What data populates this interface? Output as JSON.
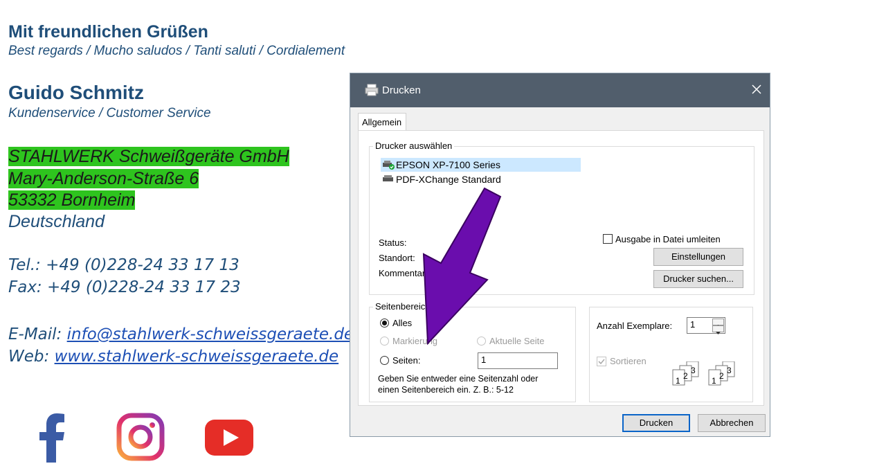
{
  "signature": {
    "greeting": "Mit freundlichen Grüßen",
    "greeting_sub": "Best regards / Mucho saludos / Tanti saluti / Cordialement",
    "name": "Guido Schmitz",
    "role": "Kundenservice / Customer Service",
    "company": "STAHLWERK Schweißgeräte GmbH",
    "street": "Mary-Anderson-Straße 6",
    "city": "53332 Bornheim",
    "country": "Deutschland",
    "tel": "Tel.: +49 (0)228-24 33 17 13",
    "fax": "Fax: +49 (0)228-24 33 17 23",
    "email_label": "E-Mail: ",
    "email": "info@stahlwerk-schweissgeraete.de",
    "web_label": "Web: ",
    "web": "www.stahlwerk-schweissgeraete.de",
    "highlight_color": "#2ec41e",
    "text_color": "#1f4e79"
  },
  "social": {
    "icons": [
      "facebook-icon",
      "instagram-icon",
      "youtube-icon"
    ]
  },
  "dialog": {
    "title": "Drucken",
    "tab": "Allgemein",
    "printer_group": "Drucker auswählen",
    "printers": [
      {
        "name": "EPSON XP-7100 Series",
        "selected": true
      },
      {
        "name": "PDF-XChange Standard",
        "selected": false
      }
    ],
    "status_label": "Status:",
    "location_label": "Standort:",
    "comment_label": "Kommentar:",
    "print_to_file": "Ausgabe in Datei umleiten",
    "settings_button": "Einstellungen",
    "find_printer_button": "Drucker suchen...",
    "range_group": "Seitenbereich",
    "range_all": "Alles",
    "range_selection": "Markierung",
    "range_current": "Aktuelle Seite",
    "range_pages": "Seiten:",
    "pages_value": "1",
    "range_hint_line1": "Geben Sie entweder eine Seitenzahl oder",
    "range_hint_line2": "einen Seitenbereich ein. Z. B.: 5-12",
    "copies_label": "Anzahl Exemplare:",
    "copies_value": "1",
    "collate_label": "Sortieren",
    "collate_pages": [
      "1",
      "2",
      "3",
      "1",
      "2",
      "3"
    ],
    "print_button": "Drucken",
    "cancel_button": "Abbrechen"
  },
  "arrow_color": "#6a0dad"
}
